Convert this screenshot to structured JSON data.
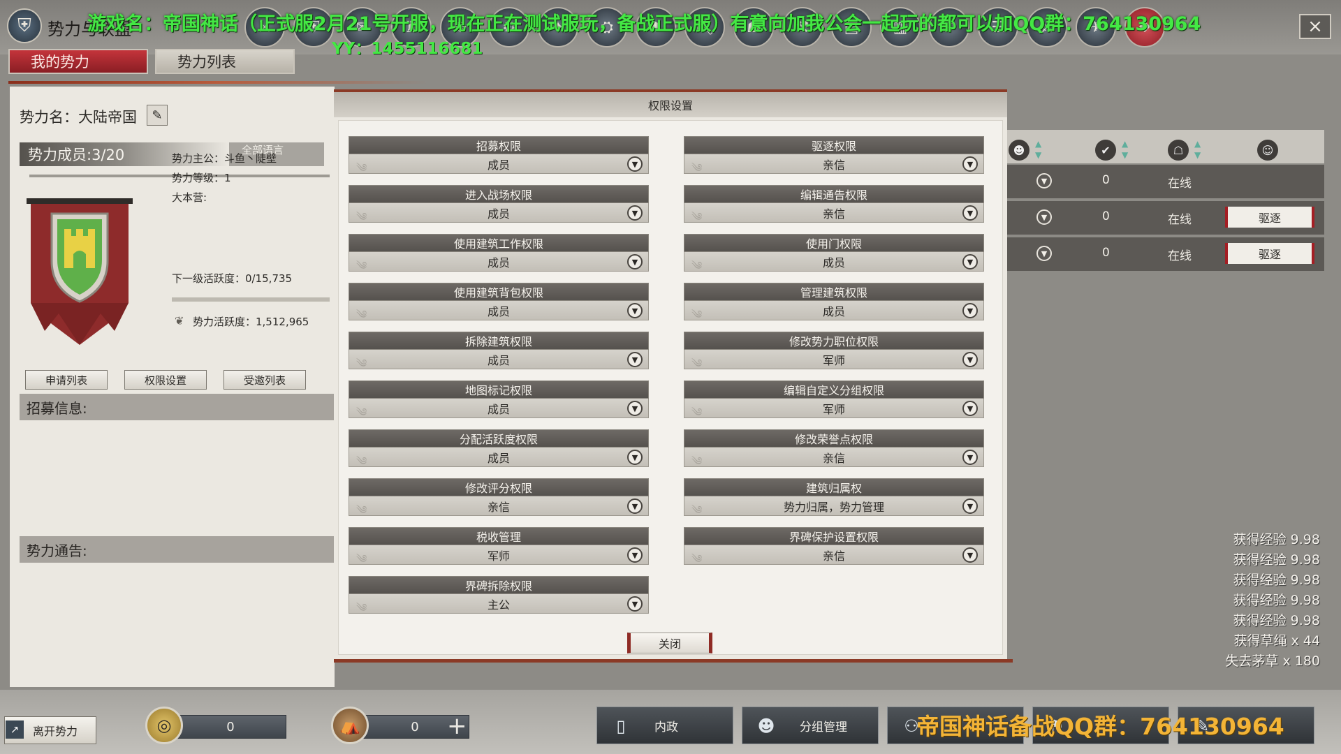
{
  "window": {
    "title": "势力与联盟",
    "close_icon": "×"
  },
  "overlay": {
    "line1": "游戏名：帝国神话（正式服2月21号开服，现在正在测试服玩，备战正式服）有意向加我公会一起玩的都可以加QQ群：764130964",
    "line2": "YY：1455116681",
    "bottom": "帝国神话备战QQ群：764130964"
  },
  "top_icons": [
    "⚔",
    "⛨",
    "✉",
    "♜",
    "☸",
    "⚙",
    "✦",
    "⛭",
    "⚑",
    "⛏",
    "☗",
    "⚒",
    "▤",
    "▥",
    "⚐",
    "☰",
    "⚔",
    "✈",
    "❖"
  ],
  "tabs": {
    "my": "我的势力",
    "list": "势力列表"
  },
  "faction": {
    "name": "势力名：大陆帝国",
    "members": "势力成员:3/20",
    "language": "全部语言",
    "lord": "势力主公：斗鱼丶陡壁",
    "level": "势力等级：1",
    "camp": "大本营:",
    "next_activity": "下一级活跃度：0/15,735",
    "next_activity_progress": 0,
    "activity": "势力活跃度：1,512,965"
  },
  "sub_buttons": {
    "apply": "申请列表",
    "perm": "权限设置",
    "invite": "受邀列表"
  },
  "sections": {
    "recruit": "招募信息:",
    "notice": "势力通告:"
  },
  "members_table": {
    "rows": [
      {
        "value": "0",
        "status": "在线",
        "kick": ""
      },
      {
        "value": "0",
        "status": "在线",
        "kick": "驱逐"
      },
      {
        "value": "0",
        "status": "在线",
        "kick": "驱逐"
      }
    ]
  },
  "log": [
    "获得经验 9.98",
    "获得经验 9.98",
    "获得经验 9.98",
    "获得经验 9.98",
    "获得经验 9.98",
    "获得草绳 x 44",
    "失去茅草 x 180"
  ],
  "dialog": {
    "title": "权限设置",
    "close": "关闭",
    "left": [
      {
        "label": "招募权限",
        "value": "成员"
      },
      {
        "label": "进入战场权限",
        "value": "成员"
      },
      {
        "label": "使用建筑工作权限",
        "value": "成员"
      },
      {
        "label": "使用建筑背包权限",
        "value": "成员"
      },
      {
        "label": "拆除建筑权限",
        "value": "成员"
      },
      {
        "label": "地图标记权限",
        "value": "成员"
      },
      {
        "label": "分配活跃度权限",
        "value": "成员"
      },
      {
        "label": "修改评分权限",
        "value": "亲信"
      },
      {
        "label": "税收管理",
        "value": "军师"
      },
      {
        "label": "界碑拆除权限",
        "value": "主公"
      }
    ],
    "right": [
      {
        "label": "驱逐权限",
        "value": "亲信"
      },
      {
        "label": "编辑通告权限",
        "value": "亲信"
      },
      {
        "label": "使用门权限",
        "value": "成员"
      },
      {
        "label": "管理建筑权限",
        "value": "成员"
      },
      {
        "label": "修改势力职位权限",
        "value": "军师"
      },
      {
        "label": "编辑自定义分组权限",
        "value": "军师"
      },
      {
        "label": "修改荣誉点权限",
        "value": "亲信"
      },
      {
        "label": "建筑归属权",
        "value": "势力归属，势力管理"
      },
      {
        "label": "界碑保护设置权限",
        "value": "亲信"
      }
    ]
  },
  "bottom": {
    "leave": "离开势力",
    "currency1": "0",
    "currency2": "0",
    "func1": "内政",
    "func2": "分组管理"
  }
}
